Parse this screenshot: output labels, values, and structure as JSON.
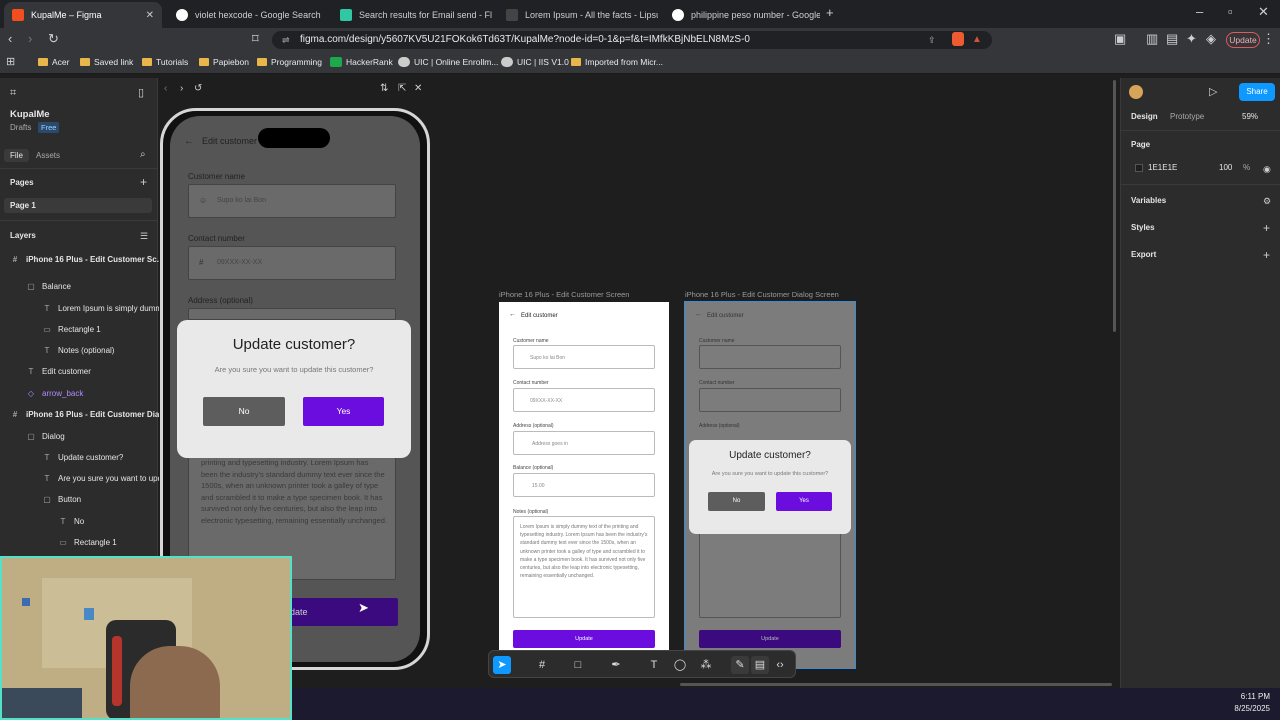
{
  "browser": {
    "tabs": [
      {
        "title": "KupalMe – Figma",
        "active": true,
        "icon_color": "#f24e1e"
      },
      {
        "title": "violet hexcode - Google Search",
        "active": false,
        "icon_color": "#ffffff"
      },
      {
        "title": "Search results for Email send - Flatic",
        "active": false,
        "icon_color": "#2fc8a2"
      },
      {
        "title": "Lorem Ipsum - All the facts - Lipsum",
        "active": false,
        "icon_color": "#444444"
      },
      {
        "title": "philippine peso number - Google Se",
        "active": false,
        "icon_color": "#ffffff"
      }
    ],
    "url": "figma.com/design/y5607KV5U21FOKok6Td63T/KupalMe?node-id=0-1&p=f&t=IMfkKBjNbELN8MzS-0",
    "update_label": "Update",
    "bookmarks": [
      "Acer",
      "Saved link",
      "Tutorials",
      "Papiebon",
      "Programming",
      "HackerRank",
      "UIC | Online Enrollm...",
      "UIC | IIS V1.0",
      "Imported from Micr..."
    ]
  },
  "figma": {
    "file_name": "KupalMe",
    "drafts": "Drafts",
    "plan": "Free",
    "tab_file": "File",
    "tab_assets": "Assets",
    "pages_heading": "Pages",
    "page_1": "Page 1",
    "layers_heading": "Layers",
    "layers": [
      {
        "label": "iPhone 16 Plus - Edit Customer Sc...",
        "icon": "#",
        "indent": 0,
        "bold": true
      },
      {
        "label": "Balance",
        "icon": "▢",
        "indent": 1
      },
      {
        "label": "Lorem Ipsum is simply dumm",
        "icon": "T",
        "indent": 2
      },
      {
        "label": "Rectangle 1",
        "icon": "▭",
        "indent": 2
      },
      {
        "label": "Notes (optional)",
        "icon": "T",
        "indent": 2
      },
      {
        "label": "Edit customer",
        "icon": "T",
        "indent": 1
      },
      {
        "label": "arrow_back",
        "icon": "◇",
        "indent": 1,
        "purple": true
      },
      {
        "label": "iPhone 16 Plus - Edit Customer Dialog",
        "icon": "#",
        "indent": 0,
        "bold": true
      },
      {
        "label": "Dialog",
        "icon": "▢",
        "indent": 1
      },
      {
        "label": "Update customer?",
        "icon": "T",
        "indent": 2
      },
      {
        "label": "Are you sure you want to upd",
        "icon": "T",
        "indent": 2
      },
      {
        "label": "Button",
        "icon": "▢",
        "indent": 2
      },
      {
        "label": "No",
        "icon": "T",
        "indent": 3
      },
      {
        "label": "Rectangle 1",
        "icon": "▭",
        "indent": 3
      }
    ],
    "right": {
      "tab_design": "Design",
      "tab_prototype": "Prototype",
      "zoom": "59%",
      "share_label": "Share",
      "page_heading": "Page",
      "page_color": "1E1E1E",
      "page_opacity": "100",
      "percent": "%",
      "variables": "Variables",
      "styles": "Styles",
      "export": "Export"
    }
  },
  "preview": {
    "screen_title": "Edit customer",
    "customer_name_label": "Customer name",
    "customer_name_placeholder": "Supo ko lai Bon",
    "contact_label": "Contact number",
    "contact_placeholder": "09XXX-XX-XX",
    "address_label": "Address (optional)",
    "dialog_title": "Update customer?",
    "dialog_message": "Are you sure you want to update this customer?",
    "no_label": "No",
    "yes_label": "Yes",
    "notes_text": "printing and typesetting industry. Lorem Ipsum has been the industry's standard dummy text ever since the 1500s, when an unknown printer took a galley of type and scrambled it to make a type specimen book. It has survived not only five centuries, but also the leap into electronic typesetting, remaining essentially unchanged.",
    "update_label": "Update"
  },
  "frames": {
    "frame1_title": "iPhone 16 Plus - Edit Customer Screen",
    "frame2_title": "iPhone 16 Plus - Edit Customer Dialog Screen",
    "edit_customer": "Edit customer",
    "customer_name": "Customer name",
    "contact_number": "Contact number",
    "address": "Address (optional)",
    "address_ph": "Address goes in",
    "balance": "Balance (optional)",
    "balance_ph": "15.00",
    "notes": "Notes (optional)",
    "notes_text": "Lorem Ipsum is simply dummy text of the printing and typesetting industry. Lorem Ipsum has been the industry's standard dummy text ever since the 1500s, when an unknown printer took a galley of type and scrambled it to make a type specimen book. It has survived not only five centuries, but also the leap into electronic typesetting, remaining essentially unchanged.",
    "update": "Update",
    "dialog_title": "Update customer?",
    "dialog_message": "Are you sure you want to update this customer?",
    "no": "No",
    "yes": "Yes"
  },
  "taskbar": {
    "time": "6:11 PM",
    "date": "8/25/2025"
  },
  "colors": {
    "accent_purple": "#6a0dde",
    "figma_blue": "#0d99ff"
  }
}
